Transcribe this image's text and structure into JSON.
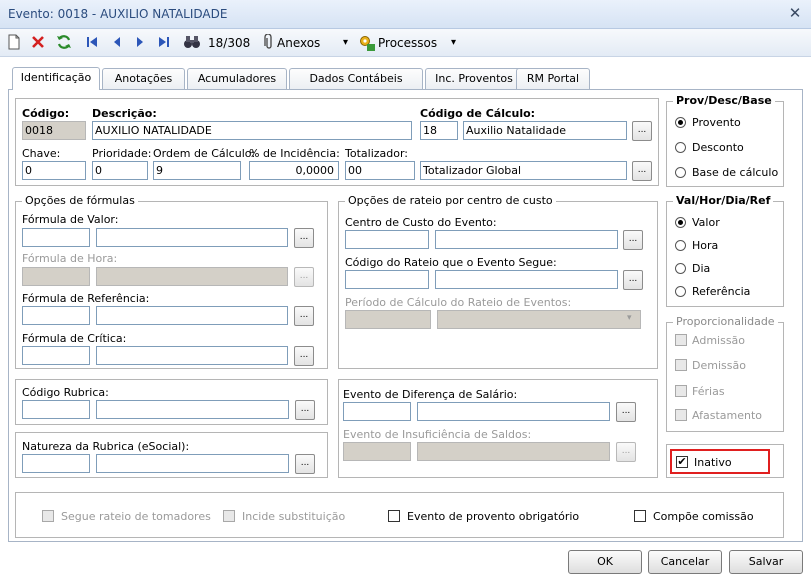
{
  "window": {
    "title": "Evento: 0018 - AUXILIO NATALIDADE",
    "close_glyph": "✕"
  },
  "toolbar": {
    "record_position": "18/308",
    "anexos_label": "Anexos",
    "processos_label": "Processos",
    "dropdown_glyph": "▾"
  },
  "tabs": [
    {
      "label": "Identificação",
      "active": true
    },
    {
      "label": "Anotações"
    },
    {
      "label": "Acumuladores"
    },
    {
      "label": "Dados Contábeis"
    },
    {
      "label": "Inc. Proventos"
    },
    {
      "label": "RM Portal"
    }
  ],
  "ident": {
    "codigo_label": "Código:",
    "codigo_value": "0018",
    "descricao_label": "Descrição:",
    "descricao_value": "AUXILIO NATALIDADE",
    "calc_label": "Código de Cálculo:",
    "calc_code": "18",
    "calc_name": "Auxilio Natalidade",
    "chave_label": "Chave:",
    "chave_value": "0",
    "prioridade_label": "Prioridade:",
    "prioridade_value": "0",
    "ordem_label": "Ordem de Cálculo:",
    "ordem_value": "9",
    "incidencia_label": "% de Incidência:",
    "incidencia_value": "0,0000",
    "totalizador_label": "Totalizador:",
    "totalizador_code": "00",
    "totalizador_name": "Totalizador Global",
    "browse": "..."
  },
  "formulas": {
    "legend": "Opções de fórmulas",
    "valor": "Fórmula de Valor:",
    "hora": "Fórmula de Hora:",
    "referencia": "Fórmula de Referência:",
    "critica": "Fórmula de Crítica:"
  },
  "rateio": {
    "legend": "Opções de rateio por centro de custo",
    "centro": "Centro de Custo do Evento:",
    "codigo": "Código do Rateio que o Evento Segue:",
    "periodo": "Período de Cálculo do Rateio de Eventos:"
  },
  "rubrica": {
    "codigo": "Código Rubrica:",
    "natureza": "Natureza da Rubrica (eSocial):"
  },
  "diferenca": {
    "evento_dif": "Evento de Diferença de Salário:",
    "evento_insuf": "Evento de Insuficiência de Saldos:"
  },
  "prov": {
    "legend": "Prov/Desc/Base",
    "options": [
      "Provento",
      "Desconto",
      "Base de cálculo"
    ],
    "selected": 0
  },
  "valhor": {
    "legend": "Val/Hor/Dia/Ref",
    "options": [
      "Valor",
      "Hora",
      "Dia",
      "Referência"
    ],
    "selected": 0
  },
  "proporc": {
    "legend": "Proporcionalidade",
    "options": [
      "Admissão",
      "Demissão",
      "Férias",
      "Afastamento"
    ]
  },
  "inativo": {
    "label": "Inativo",
    "checked": true,
    "highlight_color": "#e01f1f"
  },
  "bottom_checks": [
    {
      "label": "Segue rateio de tomadores",
      "enabled": false
    },
    {
      "label": "Incide substituição",
      "enabled": false
    },
    {
      "label": "Evento de provento obrigatório",
      "enabled": true
    },
    {
      "label": "Compõe comissão",
      "enabled": true
    }
  ],
  "buttons": {
    "ok": "OK",
    "cancelar": "Cancelar",
    "salvar": "Salvar"
  },
  "colors": {
    "title_text": "#2b4c7e",
    "delete_red": "#d42020",
    "refresh_green": "#2a8a2a",
    "nav_blue": "#2c56b8"
  }
}
